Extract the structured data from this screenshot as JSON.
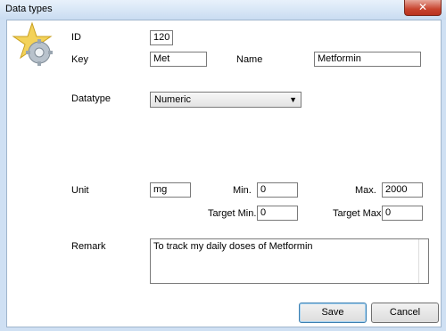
{
  "window": {
    "title": "Data types",
    "close_glyph": "✕"
  },
  "icon": "star-gear-icon",
  "form": {
    "id_label": "ID",
    "id_value": "120",
    "key_label": "Key",
    "key_value": "Met",
    "name_label": "Name",
    "name_value": "Metformin",
    "datatype_label": "Datatype",
    "datatype_value": "Numeric",
    "unit_label": "Unit",
    "unit_value": "mg",
    "min_label": "Min.",
    "min_value": "0",
    "max_label": "Max.",
    "max_value": "2000",
    "target_min_label": "Target Min.",
    "target_min_value": "0",
    "target_max_label": "Target Max.",
    "target_max_value": "0",
    "remark_label": "Remark",
    "remark_value": "To track my daily doses of Metformin"
  },
  "buttons": {
    "save": "Save",
    "cancel": "Cancel"
  },
  "colors": {
    "close": "#c8442f",
    "titlebar": "#c9dcf1"
  }
}
